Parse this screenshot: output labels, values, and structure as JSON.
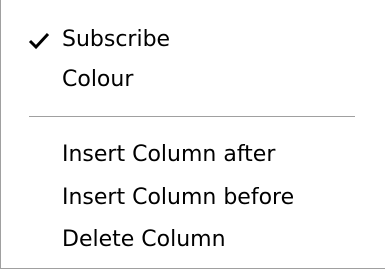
{
  "menu": {
    "items": [
      {
        "label": "Subscribe",
        "checked": true
      },
      {
        "label": "Colour",
        "checked": false
      },
      {
        "label": "Insert Column after",
        "checked": false
      },
      {
        "label": "Insert Column before",
        "checked": false
      },
      {
        "label": "Delete Column",
        "checked": false
      }
    ],
    "check_icon": "checkmark-icon"
  }
}
